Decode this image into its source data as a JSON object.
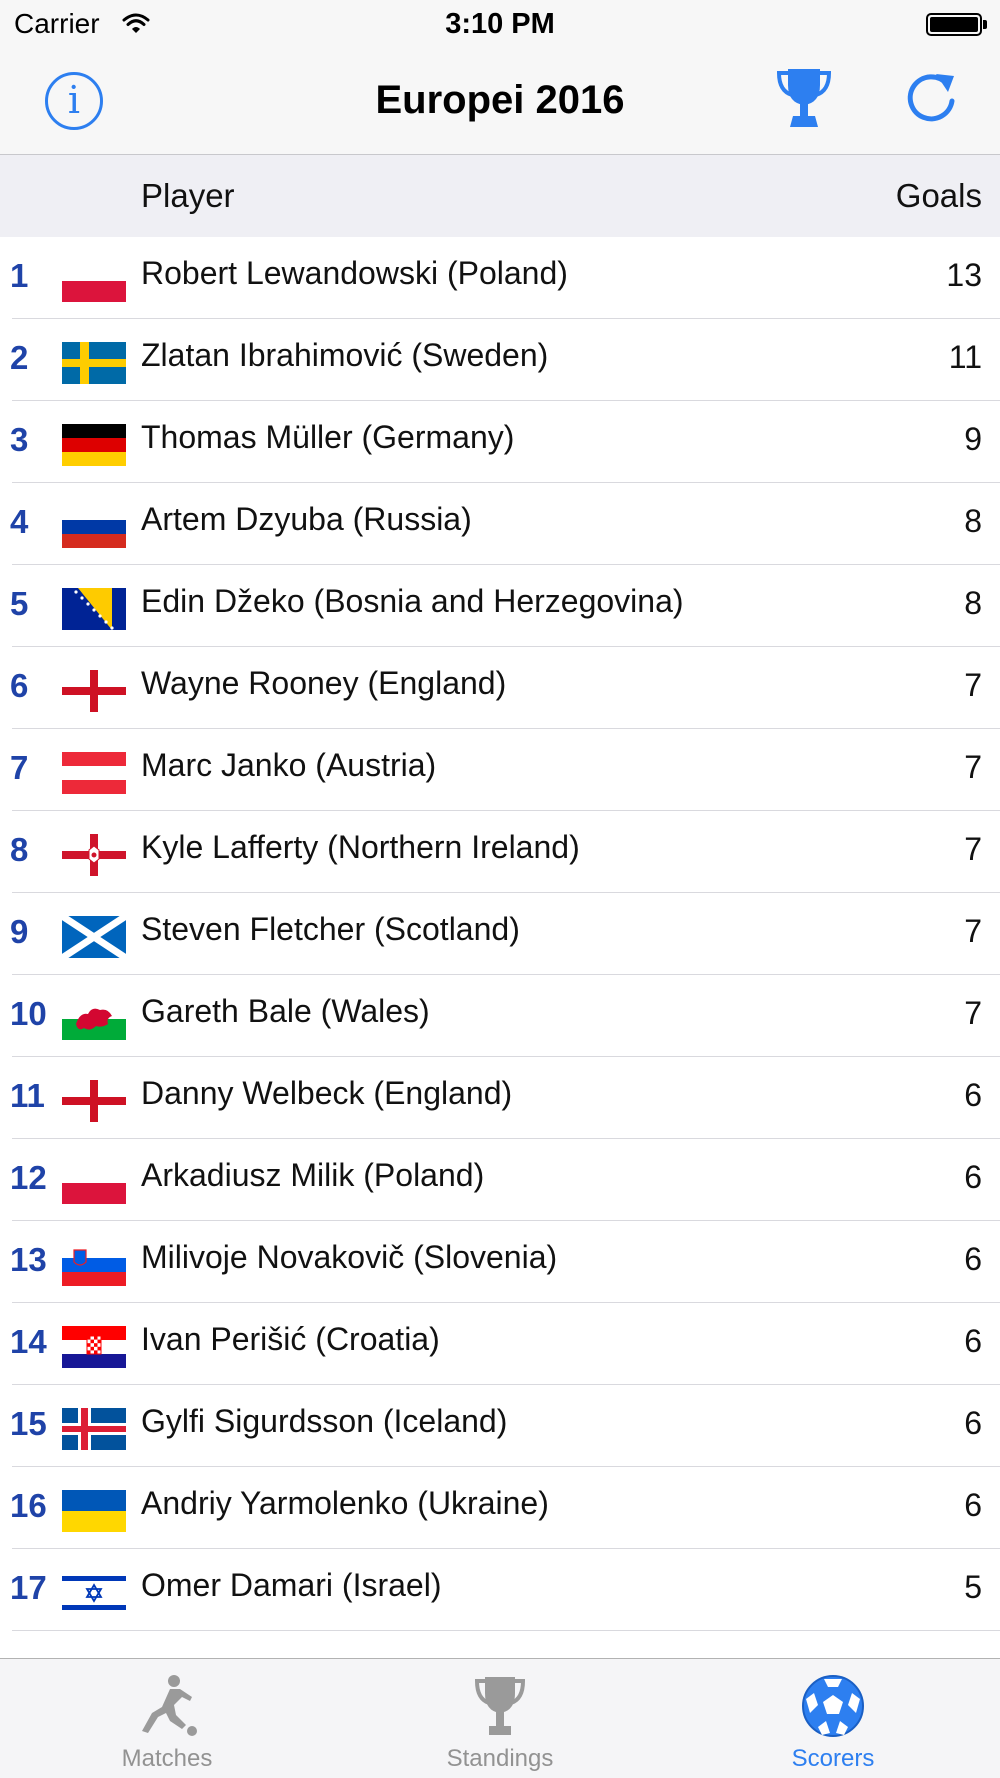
{
  "status_bar": {
    "carrier": "Carrier",
    "time": "3:10 PM"
  },
  "nav": {
    "title": "Europei 2016",
    "info_icon": "info-icon",
    "trophy_icon": "trophy-icon",
    "refresh_icon": "refresh-icon",
    "accent": "#2d7ff0"
  },
  "table_header": {
    "player": "Player",
    "goals": "Goals"
  },
  "rows": [
    {
      "rank": "1",
      "flag": "poland",
      "name": "Robert Lewandowski (Poland)",
      "goals": "13"
    },
    {
      "rank": "2",
      "flag": "sweden",
      "name": "Zlatan Ibrahimović (Sweden)",
      "goals": "11"
    },
    {
      "rank": "3",
      "flag": "germany",
      "name": "Thomas Müller (Germany)",
      "goals": "9"
    },
    {
      "rank": "4",
      "flag": "russia",
      "name": "Artem Dzyuba (Russia)",
      "goals": "8"
    },
    {
      "rank": "5",
      "flag": "bosnia",
      "name": "Edin Džeko (Bosnia and Herzegovina)",
      "goals": "8"
    },
    {
      "rank": "6",
      "flag": "england",
      "name": "Wayne Rooney (England)",
      "goals": "7"
    },
    {
      "rank": "7",
      "flag": "austria",
      "name": "Marc Janko (Austria)",
      "goals": "7"
    },
    {
      "rank": "8",
      "flag": "northern-ireland",
      "name": "Kyle Lafferty (Northern Ireland)",
      "goals": "7"
    },
    {
      "rank": "9",
      "flag": "scotland",
      "name": "Steven Fletcher (Scotland)",
      "goals": "7"
    },
    {
      "rank": "10",
      "flag": "wales",
      "name": "Gareth Bale (Wales)",
      "goals": "7"
    },
    {
      "rank": "11",
      "flag": "england",
      "name": "Danny Welbeck (England)",
      "goals": "6"
    },
    {
      "rank": "12",
      "flag": "poland",
      "name": "Arkadiusz Milik (Poland)",
      "goals": "6"
    },
    {
      "rank": "13",
      "flag": "slovenia",
      "name": "Milivoje Novakovič (Slovenia)",
      "goals": "6"
    },
    {
      "rank": "14",
      "flag": "croatia",
      "name": "Ivan Perišić (Croatia)",
      "goals": "6"
    },
    {
      "rank": "15",
      "flag": "iceland",
      "name": "Gylfi Sigurdsson (Iceland)",
      "goals": "6"
    },
    {
      "rank": "16",
      "flag": "ukraine",
      "name": "Andriy Yarmolenko (Ukraine)",
      "goals": "6"
    },
    {
      "rank": "17",
      "flag": "israel",
      "name": "Omer Damari (Israel)",
      "goals": "5"
    }
  ],
  "tabs": [
    {
      "label": "Matches",
      "icon": "soccer-player-icon",
      "active": false
    },
    {
      "label": "Standings",
      "icon": "trophy-icon",
      "active": false
    },
    {
      "label": "Scorers",
      "icon": "soccer-ball-icon",
      "active": true
    }
  ]
}
